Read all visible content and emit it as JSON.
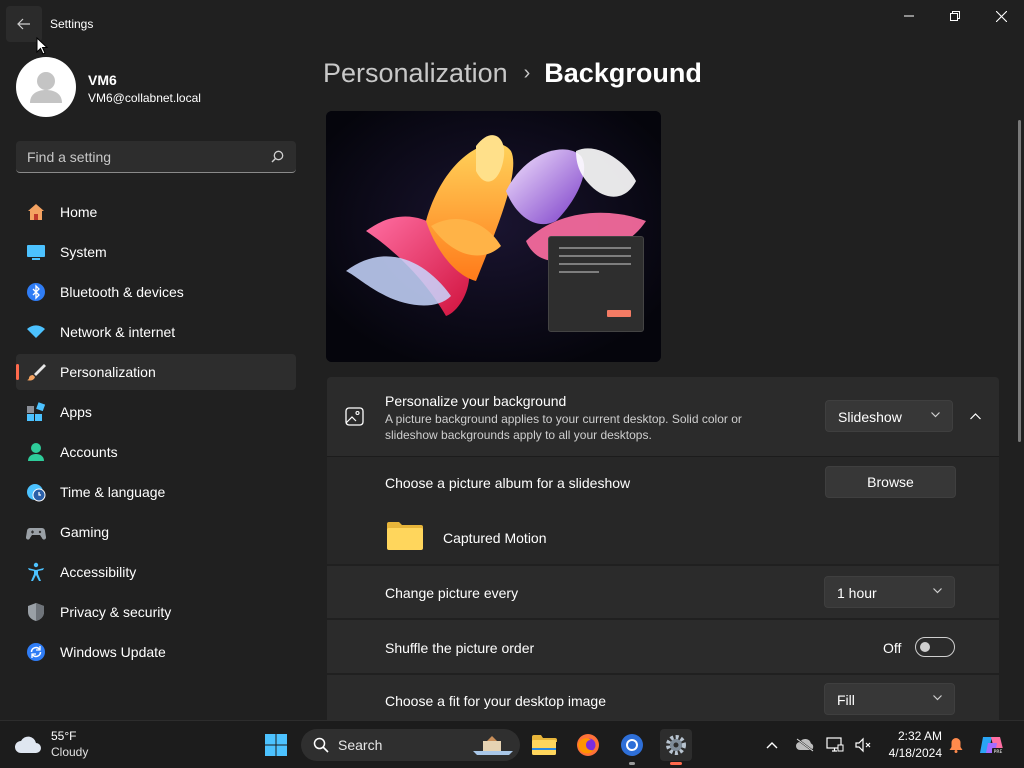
{
  "window": {
    "title": "Settings"
  },
  "profile": {
    "name": "VM6",
    "email": "VM6@collabnet.local"
  },
  "search": {
    "placeholder": "Find a setting"
  },
  "nav": [
    {
      "label": "Home",
      "icon": "home-icon",
      "active": false
    },
    {
      "label": "System",
      "icon": "system-icon",
      "active": false
    },
    {
      "label": "Bluetooth & devices",
      "icon": "bluetooth-icon",
      "active": false
    },
    {
      "label": "Network & internet",
      "icon": "wifi-icon",
      "active": false
    },
    {
      "label": "Personalization",
      "icon": "paintbrush-icon",
      "active": true
    },
    {
      "label": "Apps",
      "icon": "apps-icon",
      "active": false
    },
    {
      "label": "Accounts",
      "icon": "accounts-icon",
      "active": false
    },
    {
      "label": "Time & language",
      "icon": "clock-globe-icon",
      "active": false
    },
    {
      "label": "Gaming",
      "icon": "gamepad-icon",
      "active": false
    },
    {
      "label": "Accessibility",
      "icon": "accessibility-icon",
      "active": false
    },
    {
      "label": "Privacy & security",
      "icon": "shield-icon",
      "active": false
    },
    {
      "label": "Windows Update",
      "icon": "update-icon",
      "active": false
    }
  ],
  "breadcrumb": {
    "parent": "Personalization",
    "separator": "›",
    "current": "Background"
  },
  "background_card": {
    "title": "Personalize your background",
    "description": "A picture background applies to your current desktop. Solid color or slideshow backgrounds apply to all your desktops.",
    "mode": "Slideshow"
  },
  "album": {
    "title": "Choose a picture album for a slideshow",
    "browse_label": "Browse",
    "folder_name": "Captured Motion"
  },
  "interval": {
    "title": "Change picture every",
    "value": "1 hour"
  },
  "shuffle": {
    "title": "Shuffle the picture order",
    "state": "Off"
  },
  "fit": {
    "title": "Choose a fit for your desktop image",
    "value": "Fill"
  },
  "taskbar": {
    "temperature": "55°F",
    "condition": "Cloudy",
    "search_label": "Search",
    "time": "2:32 AM",
    "date": "4/18/2024"
  },
  "colors": {
    "accent": "#ff6a4d",
    "background": "#202020",
    "card": "#2b2b2b"
  }
}
